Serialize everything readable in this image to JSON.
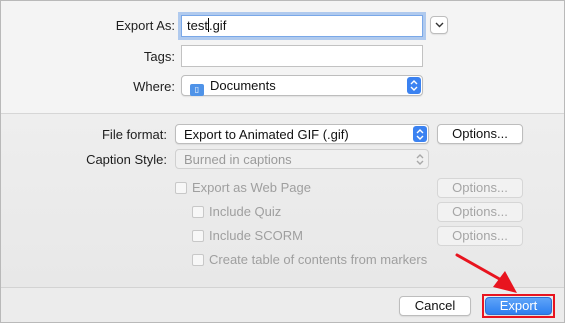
{
  "export_as": {
    "label": "Export As:",
    "value_before_caret": "test",
    "value_after_caret": ".gif"
  },
  "tags": {
    "label": "Tags:",
    "value": ""
  },
  "where": {
    "label": "Where:",
    "value": "Documents"
  },
  "file_format": {
    "label": "File format:",
    "value": "Export to Animated GIF (.gif)",
    "options_label": "Options..."
  },
  "caption_style": {
    "label": "Caption Style:",
    "value": "Burned in captions"
  },
  "checkboxes": [
    {
      "label": "Export as Web Page",
      "options_label": "Options...",
      "checked": false,
      "enabled": false
    },
    {
      "label": "Include Quiz",
      "options_label": "Options...",
      "checked": false,
      "enabled": false
    },
    {
      "label": "Include SCORM",
      "options_label": "Options...",
      "checked": false,
      "enabled": false
    },
    {
      "label": "Create table of contents from markers",
      "checked": false,
      "enabled": false
    }
  ],
  "buttons": {
    "cancel": "Cancel",
    "export": "Export"
  },
  "colors": {
    "accent": "#3b82f1",
    "highlight": "#e8141f",
    "arrow": "#e8141f"
  }
}
